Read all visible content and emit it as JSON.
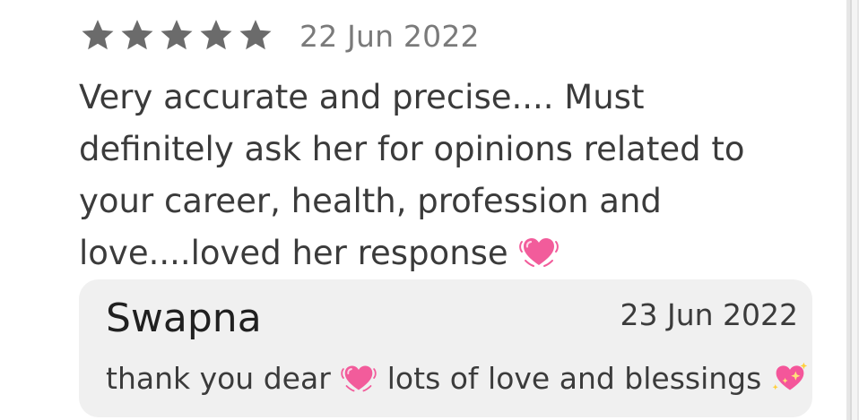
{
  "review": {
    "rating": 5,
    "rating_max": 5,
    "date": "22 Jun 2022",
    "text": "Very accurate and precise.... Must definitely ask her for opinions related to your career, health, profession and love....loved her response",
    "text_emoji": "beating-heart-emoji"
  },
  "reply": {
    "author": "Swapna",
    "date": "23 Jun 2022",
    "text_part1": "thank you dear",
    "text_part2": "lots of love and blessings",
    "emoji1": "beating-heart-emoji",
    "emoji2": "sparkling-heart-emoji"
  },
  "colors": {
    "star": "#6b6b6b",
    "date_text": "#7a7a7a",
    "body_text": "#3b3b3b",
    "reply_background": "#f0f0f0",
    "heart_pink": "#f25c9b"
  }
}
